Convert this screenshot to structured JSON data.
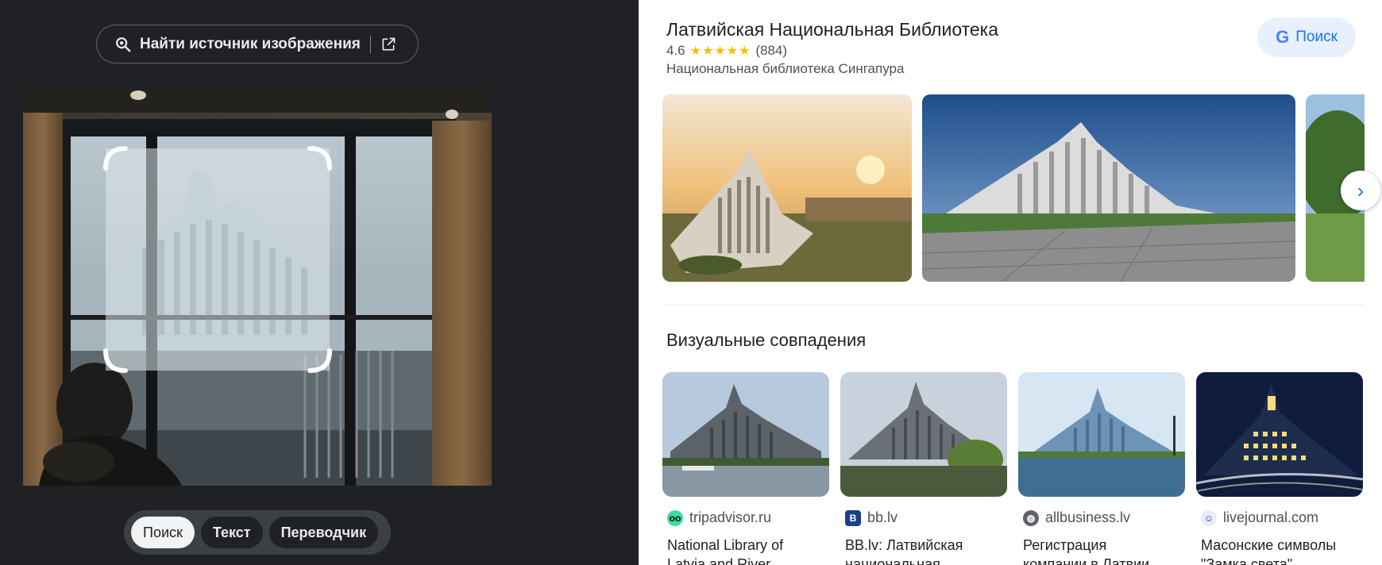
{
  "left": {
    "find_source_label": "Найти источник изображения",
    "find_source_icon": "lens-icon",
    "open_icon": "open-in-new-icon",
    "tabs": [
      {
        "label": "Поиск",
        "active": true
      },
      {
        "label": "Текст",
        "active": false
      },
      {
        "label": "Переводчик",
        "active": false
      }
    ]
  },
  "knowledge_panel": {
    "title": "Латвийская Национальная Библиотека",
    "rating": "4.6",
    "stars": "★★★★★",
    "review_count": "(884)",
    "subtitle": "Национальная библиотека Сингапура",
    "search_button": "Поиск",
    "search_logo": "G",
    "accent_color": "#1a73e8",
    "star_color": "#fbbc04"
  },
  "gallery": {
    "next_icon": "chevron-right-icon",
    "next_glyph": "›"
  },
  "visual_matches": {
    "title": "Визуальные совпадения",
    "items": [
      {
        "source": "tripadvisor.ru",
        "favicon": "tripadvisor-icon",
        "caption_line1": "National Library of",
        "caption_line2": "Latvia and River..."
      },
      {
        "source": "bb.lv",
        "favicon": "bb-icon",
        "caption_line1": "BB.lv: Латвийская",
        "caption_line2": "национальная..."
      },
      {
        "source": "allbusiness.lv",
        "favicon": "globe-icon",
        "caption_line1": "Регистрация",
        "caption_line2": "компании в Латвии..."
      },
      {
        "source": "livejournal.com",
        "favicon": "livejournal-icon",
        "caption_line1": "Масонские символы",
        "caption_line2": "\"Замка света\"..."
      }
    ]
  }
}
